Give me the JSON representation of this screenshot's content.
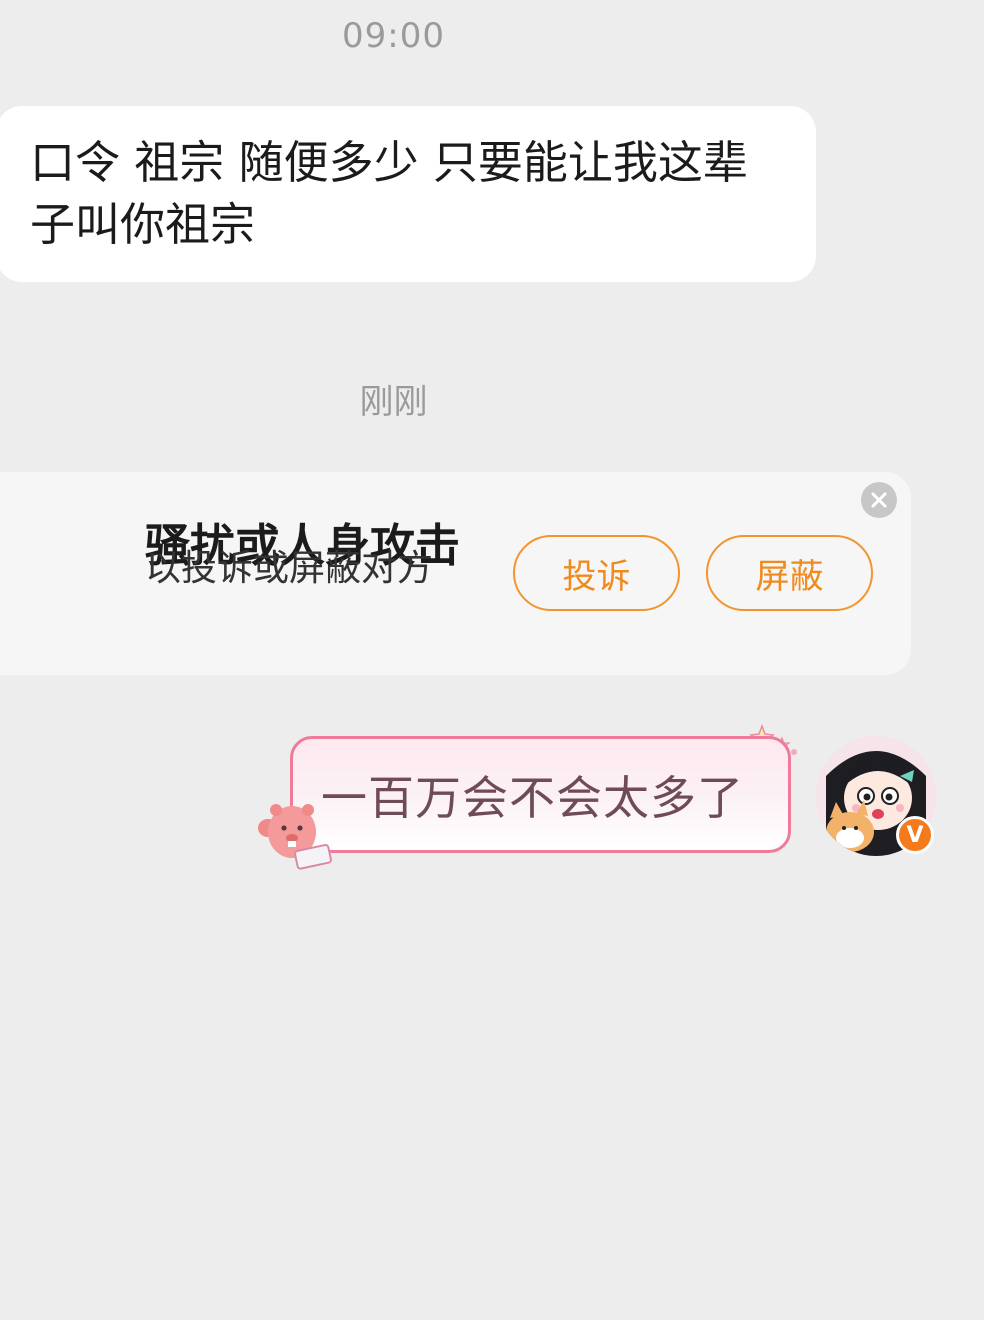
{
  "chat": {
    "time_1": "09:00",
    "incoming_message": "口令 祖宗 随便多少 只要能让我这辈子叫你祖宗",
    "time_2": "刚刚",
    "outgoing_message": "一百万会不会太多了"
  },
  "safety_notice": {
    "title": "骚扰或人身攻击",
    "subtitle": "以投诉或屏蔽对方",
    "complain_label": "投诉",
    "block_label": "屏蔽",
    "close_icon": "close-icon"
  },
  "user": {
    "verified_badge": "V"
  },
  "colors": {
    "background": "#ededed",
    "accent_orange": "#f2952e",
    "bubble_pink_border": "#f07a9a",
    "badge_orange": "#f47a1c"
  }
}
